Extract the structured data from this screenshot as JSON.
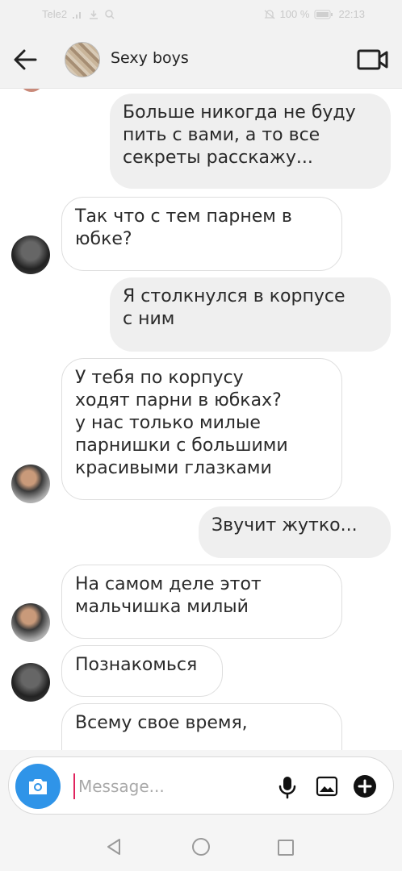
{
  "status_bar": {
    "carrier": "Tele2",
    "battery": "100 %",
    "time": "22:13"
  },
  "header": {
    "back_icon": "arrow-left-icon",
    "title": "Sexy boys",
    "video_icon": "video-camera-icon"
  },
  "messages": [
    {
      "direction": "out",
      "lines": [
        "Больше никогда не буду",
        "пить с вами, а то все",
        "секреты расскажу..."
      ]
    },
    {
      "direction": "in",
      "lines": [
        "Так что с тем парнем в",
        "юбке?"
      ]
    },
    {
      "direction": "out",
      "lines": [
        "Я столкнулся в корпусе",
        "с ним"
      ]
    },
    {
      "direction": "in",
      "lines": [
        "У тебя по корпусу",
        "ходят парни в юбках?",
        "у нас только милые",
        "парнишки с большими",
        "красивыми глазками"
      ]
    },
    {
      "direction": "out",
      "lines": [
        "Звучит жутко..."
      ]
    },
    {
      "direction": "in",
      "lines": [
        "На самом деле этот",
        "мальчишка милый"
      ]
    },
    {
      "direction": "in",
      "lines": [
        "Познакомься"
      ]
    },
    {
      "direction": "in",
      "lines": [
        "Всему свое время,"
      ]
    }
  ],
  "composer": {
    "placeholder": "Message...",
    "camera_icon": "camera-icon",
    "mic_icon": "microphone-icon",
    "gallery_icon": "image-icon",
    "add_icon": "plus-circle-icon",
    "accent_color": "#2f94e8"
  },
  "nav": {
    "back_icon": "nav-back-icon",
    "home_icon": "nav-home-icon",
    "recents_icon": "nav-recents-icon"
  }
}
